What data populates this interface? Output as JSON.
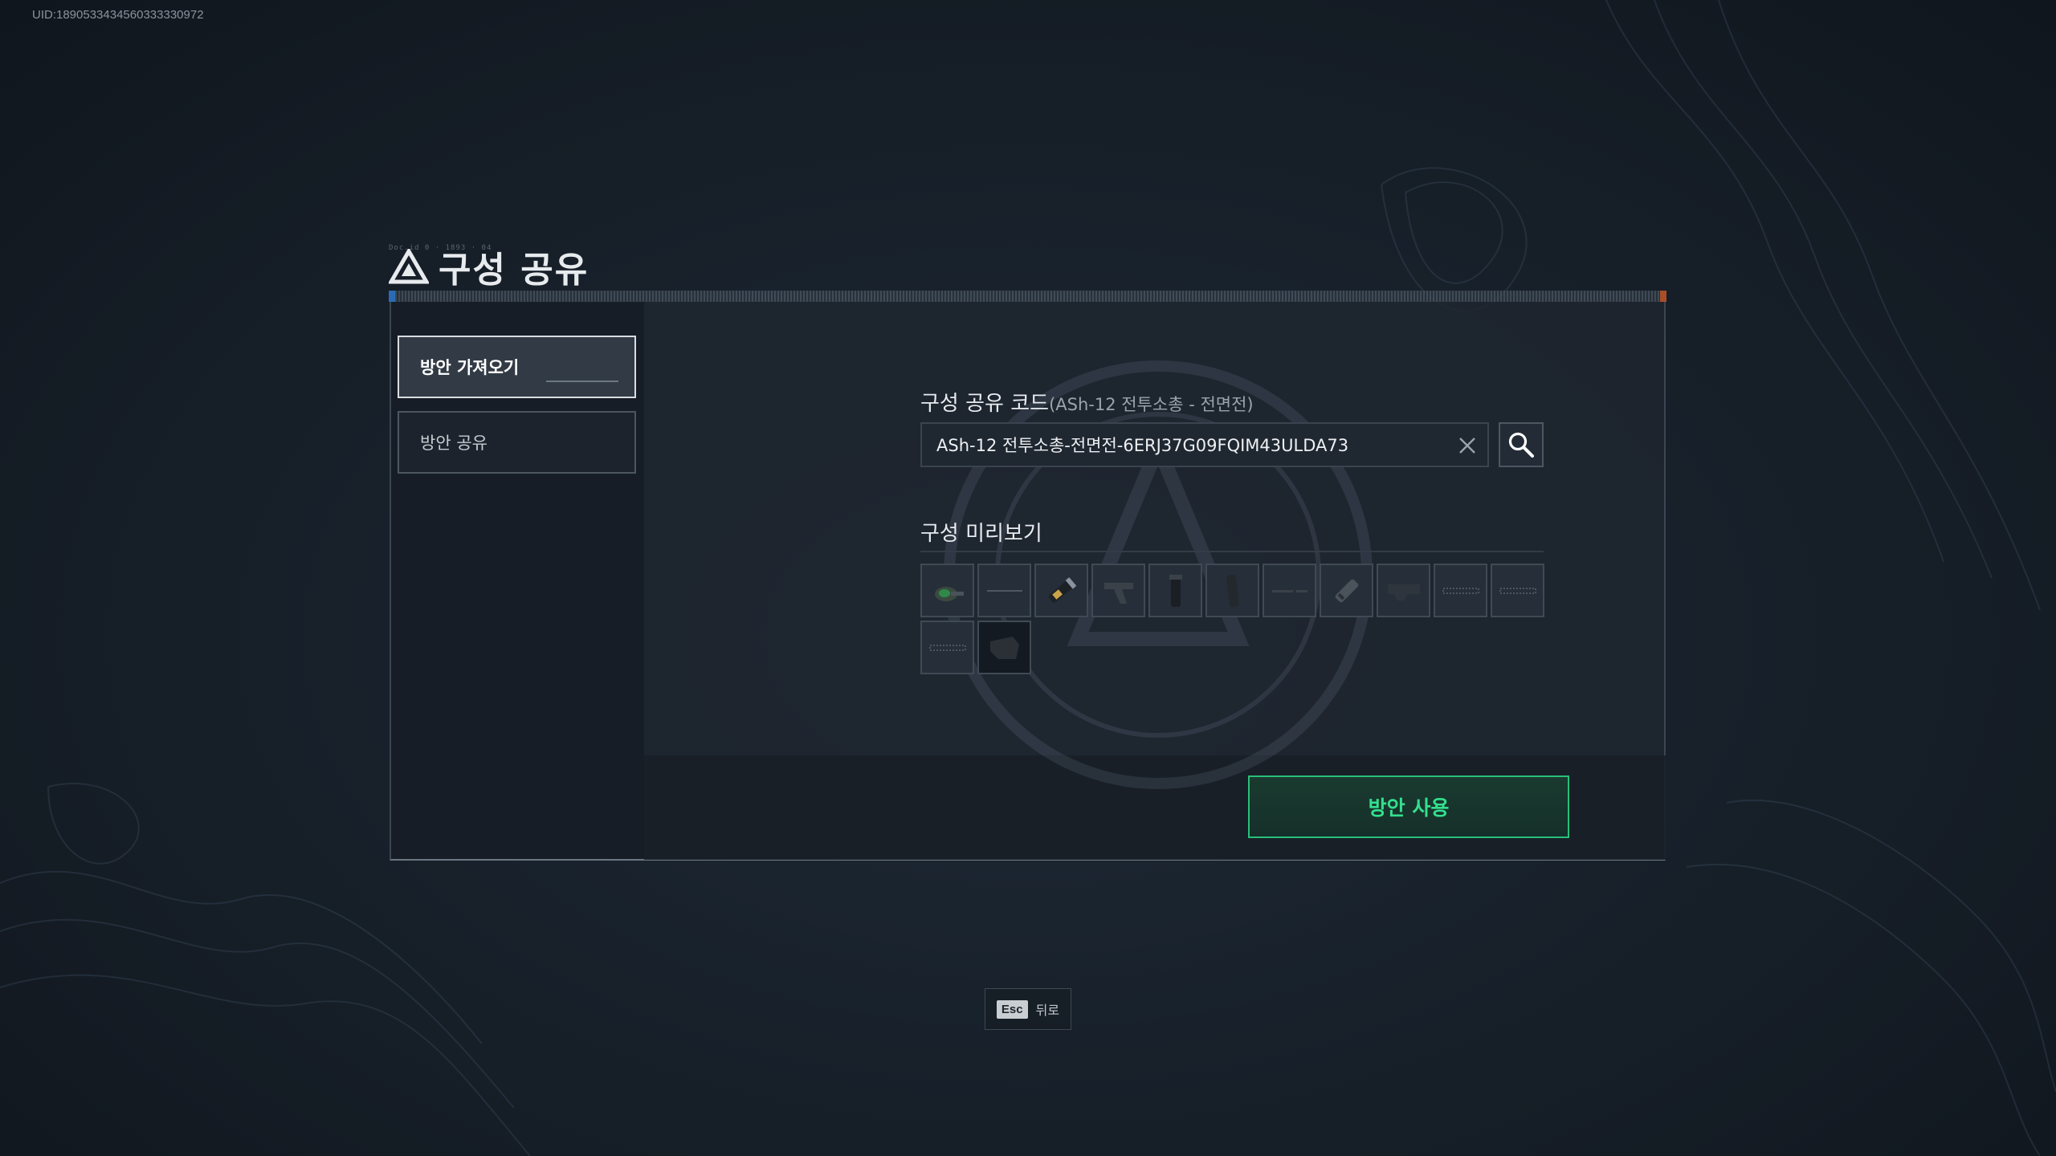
{
  "uid": "UID:1890533434560333330972",
  "header": {
    "title": "구성 공유",
    "deco": "Doc.id 0 · 1893 · 04"
  },
  "sidebar": {
    "items": [
      {
        "label": "방안 가져오기",
        "active": true
      },
      {
        "label": "방안 공유",
        "active": false
      }
    ]
  },
  "share_code": {
    "label": "구성 공유 코드",
    "sublabel": "(ASh-12 전투소총 - 전면전)",
    "value": "ASh-12 전투소총-전면전-6ERJ37G09FQIM43ULDA73",
    "clear_icon": "close-icon",
    "search_icon": "search-icon"
  },
  "preview": {
    "label": "구성 미리보기",
    "slots": [
      {
        "icon": "scope-icon",
        "accent": "#2f8a4a"
      },
      {
        "icon": "rail-icon"
      },
      {
        "icon": "flashlight-icon"
      },
      {
        "icon": "grip-icon"
      },
      {
        "icon": "foregrip-icon"
      },
      {
        "icon": "magazine-icon"
      },
      {
        "icon": "barrel-icon"
      },
      {
        "icon": "muzzle-icon"
      },
      {
        "icon": "receiver-icon"
      },
      {
        "icon": "rail-cover-icon"
      },
      {
        "icon": "rail-cover-icon"
      },
      {
        "icon": "rail-cover-icon"
      },
      {
        "icon": "stock-icon",
        "dark": true
      }
    ]
  },
  "actions": {
    "use_label": "방안 사용",
    "accent": "#28c07a"
  },
  "footer": {
    "esc_key": "Esc",
    "esc_label": "뒤로"
  }
}
